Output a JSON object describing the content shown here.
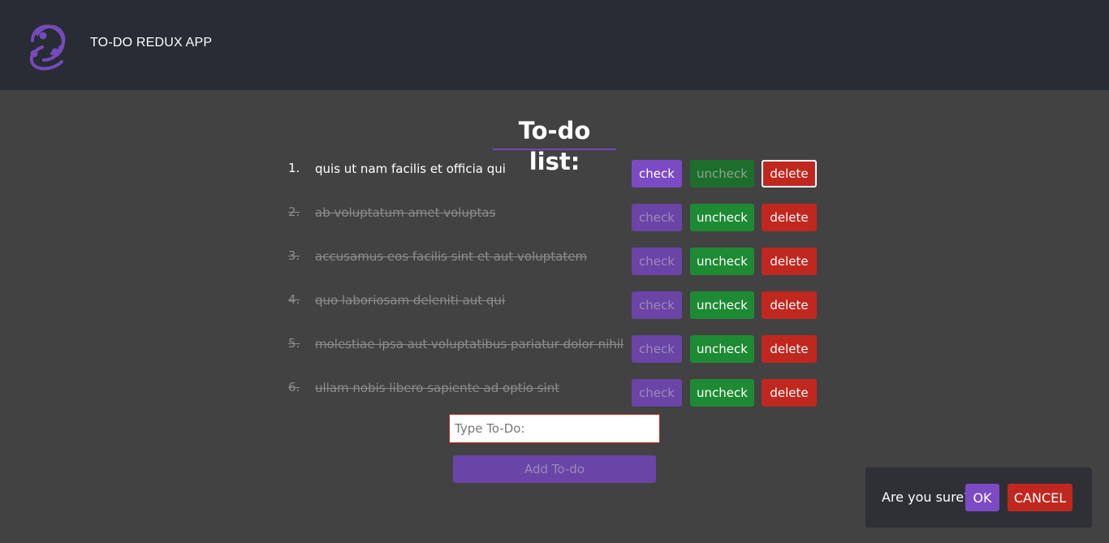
{
  "header": {
    "app_title": "TO-DO REDUX APP",
    "logo_icon": "redux-logo-icon",
    "logo_color": "#764abc"
  },
  "main": {
    "title": "To-do list:",
    "todos": [
      {
        "num": "1.",
        "text": "quis ut nam facilis et officia qui",
        "completed": false
      },
      {
        "num": "2.",
        "text": "ab voluptatum amet voluptas",
        "completed": true
      },
      {
        "num": "3.",
        "text": "accusamus eos facilis sint et aut voluptatem",
        "completed": true
      },
      {
        "num": "4.",
        "text": "quo laboriosam deleniti aut qui",
        "completed": true
      },
      {
        "num": "5.",
        "text": "molestiae ipsa aut voluptatibus pariatur dolor nihil",
        "completed": true
      },
      {
        "num": "6.",
        "text": "ullam nobis libero sapiente ad optio sint",
        "completed": true
      }
    ],
    "buttons": {
      "check": "check",
      "uncheck": "uncheck",
      "delete": "delete"
    },
    "input": {
      "placeholder": "Type To-Do:",
      "value": ""
    },
    "add_button": "Add To-do"
  },
  "dialog": {
    "text": "Are you sure?",
    "ok": "OK",
    "cancel": "CANCEL"
  },
  "colors": {
    "background": "#424242",
    "header": "#282c35",
    "purple": "#7c4ac4",
    "green": "#1e8a33",
    "red": "#c0271f"
  }
}
